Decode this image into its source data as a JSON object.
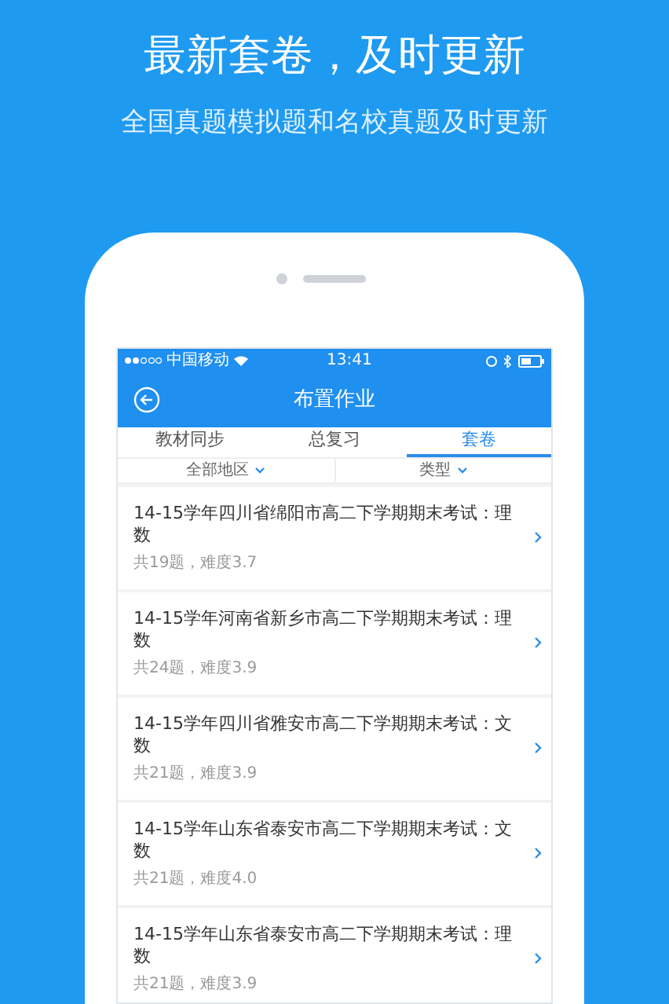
{
  "headline": "最新套卷，及时更新",
  "subheadline": "全国真题模拟题和名校真题及时更新",
  "status_bar": {
    "carrier": "中国移动",
    "time": "13:41"
  },
  "nav": {
    "title": "布置作业"
  },
  "tabs": [
    {
      "label": "教材同步",
      "selected": false
    },
    {
      "label": "总复习",
      "selected": false
    },
    {
      "label": "套卷",
      "selected": true
    }
  ],
  "filters": [
    {
      "label": "全部地区"
    },
    {
      "label": "类型"
    }
  ],
  "papers": [
    {
      "title": "14-15学年四川省绵阳市高二下学期期末考试：理数",
      "meta": "共19题，难度3.7"
    },
    {
      "title": "14-15学年河南省新乡市高二下学期期末考试：理数",
      "meta": "共24题，难度3.9"
    },
    {
      "title": "14-15学年四川省雅安市高二下学期期末考试：文数",
      "meta": "共21题，难度3.9"
    },
    {
      "title": "14-15学年山东省泰安市高二下学期期末考试：文数",
      "meta": "共21题，难度4.0"
    },
    {
      "title": "14-15学年山东省泰安市高二下学期期末考试：理数",
      "meta": "共21题，难度3.9"
    }
  ]
}
